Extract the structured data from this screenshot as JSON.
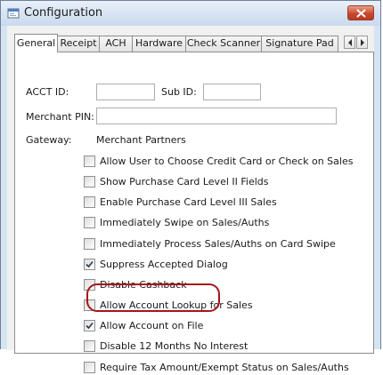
{
  "window": {
    "title": "Configuration"
  },
  "tabs": [
    {
      "label": "General",
      "active": true
    },
    {
      "label": "Receipt",
      "active": false
    },
    {
      "label": "ACH",
      "active": false
    },
    {
      "label": "Hardware",
      "active": false
    },
    {
      "label": "Check Scanner",
      "active": false
    },
    {
      "label": "Signature Pad",
      "active": false
    }
  ],
  "form": {
    "acct_id": {
      "label": "ACCT ID:",
      "value": ""
    },
    "sub_id": {
      "label": "Sub ID:",
      "value": ""
    },
    "merchant_pin": {
      "label": "Merchant PIN:",
      "value": ""
    },
    "gateway": {
      "label": "Gateway:",
      "value": "Merchant Partners"
    }
  },
  "options": [
    {
      "label": "Allow User to Choose Credit Card or Check on Sales",
      "checked": false
    },
    {
      "label": "Show Purchase Card Level II Fields",
      "checked": false
    },
    {
      "label": "Enable Purchase Card Level III Sales",
      "checked": false
    },
    {
      "label": "Immediately Swipe on Sales/Auths",
      "checked": false
    },
    {
      "label": "Immediately Process Sales/Auths on Card Swipe",
      "checked": false
    },
    {
      "label": "Suppress Accepted Dialog",
      "checked": true
    },
    {
      "label": "Disable Cashback",
      "checked": false
    },
    {
      "label": "Allow Account Lookup for Sales",
      "checked": false
    },
    {
      "label": "Allow Account on File",
      "checked": true
    },
    {
      "label": "Disable 12 Months No Interest",
      "checked": false
    },
    {
      "label": "Require Tax Amount/Exempt Status on Sales/Auths",
      "checked": false
    }
  ],
  "colors": {
    "highlight": "#a4161a",
    "titlebar": "#c9d9ee",
    "close_button": "#c8492f"
  },
  "icons": {
    "app": "app-window-icon",
    "close": "close-icon",
    "tab_scroll_left": "chevron-left-icon",
    "tab_scroll_right": "chevron-right-icon",
    "check": "checkmark-icon"
  }
}
